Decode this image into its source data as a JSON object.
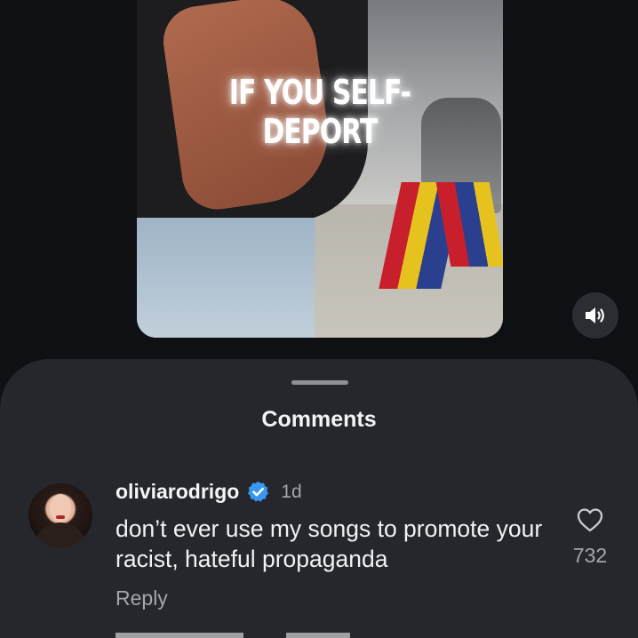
{
  "video": {
    "overlay_text": "IF YOU SELF-DEPORT"
  },
  "comments": {
    "title": "Comments",
    "items": [
      {
        "username": "oliviarodrigo",
        "verified": true,
        "time": "1d",
        "text": "don’t ever use my songs to promote your racist, hateful propaganda",
        "reply_label": "Reply",
        "like_count": "732"
      }
    ]
  },
  "icons": {
    "sound": "speaker-on-icon",
    "verified": "verified-badge-icon",
    "like": "heart-outline-icon"
  },
  "colors": {
    "verified_blue": "#3897f0",
    "sheet_background": "#25272c",
    "secondary_text": "#a3a6ad"
  }
}
